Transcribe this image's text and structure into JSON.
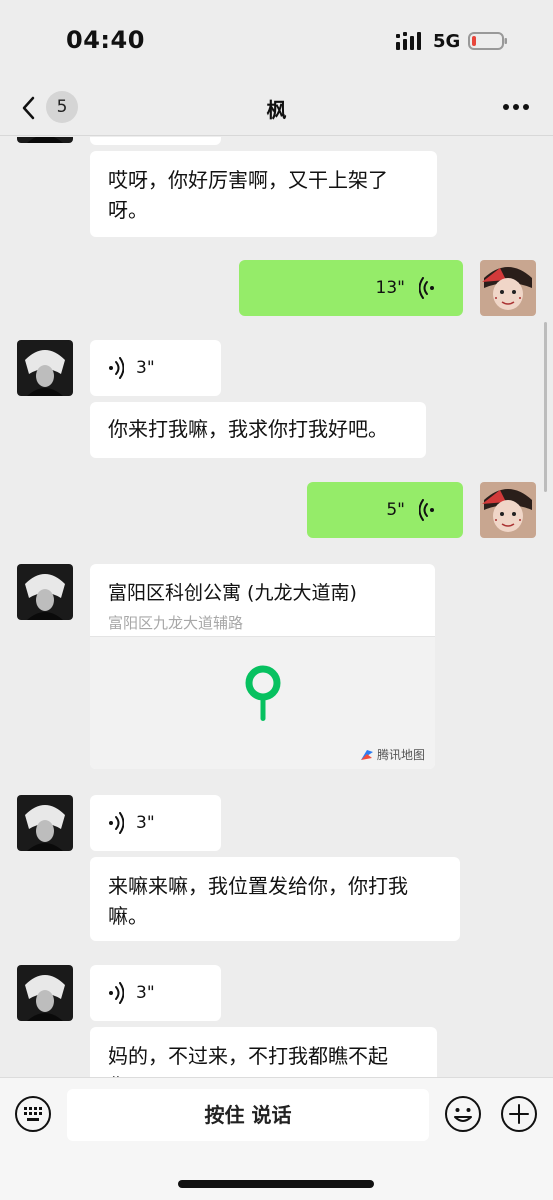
{
  "status": {
    "time": "04:40",
    "network": "5G",
    "battery_color": "#e8463b"
  },
  "nav": {
    "badge": "5",
    "title": "枫"
  },
  "messages": {
    "m1": "哎呀，你好厉害啊，又干上架了呀。",
    "v_out_1": "13\"",
    "v_in_1": "3\"",
    "m2": "你来打我嘛，我求你打我好吧。",
    "v_out_2": "5\"",
    "location": {
      "title": "富阳区科创公寓 (九龙大道南)",
      "address": "富阳区九龙大道辅路",
      "map_brand": "腾讯地图"
    },
    "v_in_2": "3\"",
    "m3": "来嘛来嘛，我位置发给你，你打我嘛。",
    "v_in_3": "3\"",
    "m4": "妈的，不过来，不打我都瞧不起你。"
  },
  "input": {
    "talk_label": "按住 说话"
  },
  "colors": {
    "bubble_out": "#95ec69",
    "bubble_in": "#ffffff",
    "map_pin": "#07c160",
    "background": "#ededed"
  }
}
